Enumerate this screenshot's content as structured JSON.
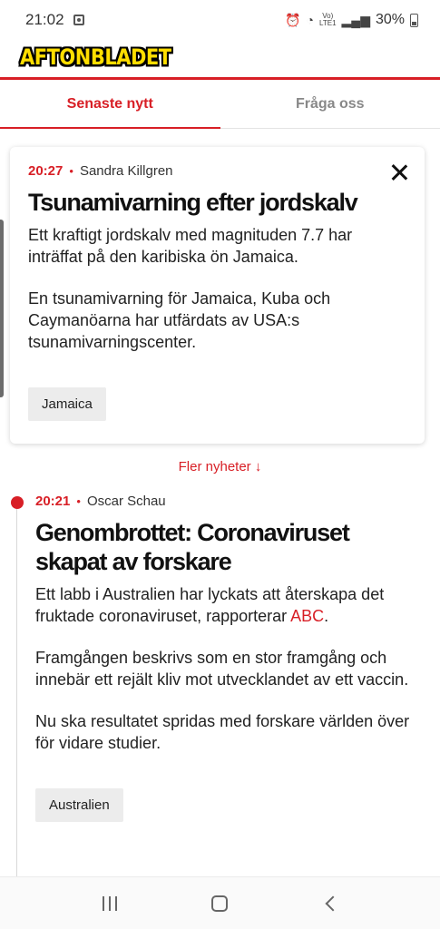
{
  "status_bar": {
    "time": "21:02",
    "network_label_top": "Vo)",
    "network_label_bottom": "LTE1",
    "battery": "30%"
  },
  "brand": {
    "logo_text": "AFTONBLADET"
  },
  "tabs": [
    {
      "label": "Senaste nytt",
      "active": true
    },
    {
      "label": "Fråga oss",
      "active": false
    }
  ],
  "featured": {
    "time": "20:27",
    "author": "Sandra Killgren",
    "headline": "Tsunamivarning efter jordskalv",
    "paragraphs": [
      "Ett kraftigt jordskalv med magnituden 7.7 har inträffat på den karibiska ön Jamaica.",
      "En tsunamivarning för Jamaica, Kuba och Caymanöarna har utfärdats av USA:s tsunamivarningscenter."
    ],
    "tag": "Jamaica"
  },
  "more_news": "Fler nyheter ↓",
  "timeline": [
    {
      "time": "20:21",
      "author": "Oscar Schau",
      "headline": "Genombrottet: Coronaviruset skapat av forskare",
      "p1_before": "Ett labb i Australien har lyckats att återskapa det fruktade coronaviruset, rapporterar ",
      "p1_link": "ABC",
      "p1_after": ".",
      "p2": "Framgången beskrivs som en stor framgång och innebär ett rejält kliv mot utvecklandet av ett vaccin.",
      "p3": "Nu ska resultatet spridas med forskare världen över för vidare studier.",
      "tag": "Australien"
    }
  ],
  "colors": {
    "accent": "#d81f26",
    "logo_yellow": "#ffde00",
    "tag_bg": "#ececec"
  }
}
